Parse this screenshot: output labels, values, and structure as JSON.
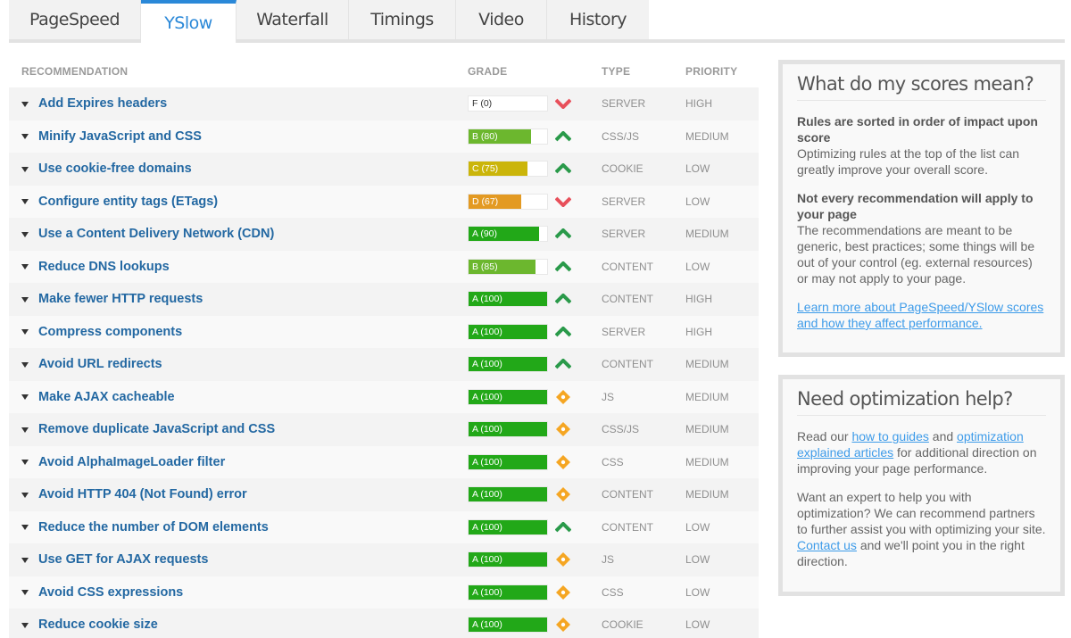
{
  "tabs": [
    {
      "label": "PageSpeed",
      "active": false
    },
    {
      "label": "YSlow",
      "active": true
    },
    {
      "label": "Waterfall",
      "active": false
    },
    {
      "label": "Timings",
      "active": false
    },
    {
      "label": "Video",
      "active": false
    },
    {
      "label": "History",
      "active": false
    }
  ],
  "table": {
    "headers": {
      "recommendation": "RECOMMENDATION",
      "grade": "GRADE",
      "type": "TYPE",
      "priority": "PRIORITY"
    },
    "rows": [
      {
        "name": "Add Expires headers",
        "grade": "F (0)",
        "score": 0,
        "color": "#ffffff",
        "trend": "down",
        "type": "SERVER",
        "priority": "HIGH"
      },
      {
        "name": "Minify JavaScript and CSS",
        "grade": "B (80)",
        "score": 80,
        "color": "#6cb72e",
        "trend": "up",
        "type": "CSS/JS",
        "priority": "MEDIUM"
      },
      {
        "name": "Use cookie-free domains",
        "grade": "C (75)",
        "score": 75,
        "color": "#cbb50a",
        "trend": "up",
        "type": "COOKIE",
        "priority": "LOW"
      },
      {
        "name": "Configure entity tags (ETags)",
        "grade": "D (67)",
        "score": 67,
        "color": "#e39a23",
        "trend": "down",
        "type": "SERVER",
        "priority": "LOW"
      },
      {
        "name": "Use a Content Delivery Network (CDN)",
        "grade": "A (90)",
        "score": 90,
        "color": "#22a818",
        "trend": "up",
        "type": "SERVER",
        "priority": "MEDIUM"
      },
      {
        "name": "Reduce DNS lookups",
        "grade": "B (85)",
        "score": 85,
        "color": "#6cb72e",
        "trend": "up",
        "type": "CONTENT",
        "priority": "LOW"
      },
      {
        "name": "Make fewer HTTP requests",
        "grade": "A (100)",
        "score": 100,
        "color": "#22a818",
        "trend": "up",
        "type": "CONTENT",
        "priority": "HIGH"
      },
      {
        "name": "Compress components",
        "grade": "A (100)",
        "score": 100,
        "color": "#22a818",
        "trend": "up",
        "type": "SERVER",
        "priority": "HIGH"
      },
      {
        "name": "Avoid URL redirects",
        "grade": "A (100)",
        "score": 100,
        "color": "#22a818",
        "trend": "up",
        "type": "CONTENT",
        "priority": "MEDIUM"
      },
      {
        "name": "Make AJAX cacheable",
        "grade": "A (100)",
        "score": 100,
        "color": "#22a818",
        "trend": "neutral",
        "type": "JS",
        "priority": "MEDIUM"
      },
      {
        "name": "Remove duplicate JavaScript and CSS",
        "grade": "A (100)",
        "score": 100,
        "color": "#22a818",
        "trend": "neutral",
        "type": "CSS/JS",
        "priority": "MEDIUM"
      },
      {
        "name": "Avoid AlphaImageLoader filter",
        "grade": "A (100)",
        "score": 100,
        "color": "#22a818",
        "trend": "neutral",
        "type": "CSS",
        "priority": "MEDIUM"
      },
      {
        "name": "Avoid HTTP 404 (Not Found) error",
        "grade": "A (100)",
        "score": 100,
        "color": "#22a818",
        "trend": "neutral",
        "type": "CONTENT",
        "priority": "MEDIUM"
      },
      {
        "name": "Reduce the number of DOM elements",
        "grade": "A (100)",
        "score": 100,
        "color": "#22a818",
        "trend": "up",
        "type": "CONTENT",
        "priority": "LOW"
      },
      {
        "name": "Use GET for AJAX requests",
        "grade": "A (100)",
        "score": 100,
        "color": "#22a818",
        "trend": "neutral",
        "type": "JS",
        "priority": "LOW"
      },
      {
        "name": "Avoid CSS expressions",
        "grade": "A (100)",
        "score": 100,
        "color": "#22a818",
        "trend": "neutral",
        "type": "CSS",
        "priority": "LOW"
      },
      {
        "name": "Reduce cookie size",
        "grade": "A (100)",
        "score": 100,
        "color": "#22a818",
        "trend": "neutral",
        "type": "COOKIE",
        "priority": "LOW"
      }
    ]
  },
  "trend_icons": {
    "up": {
      "icon": "chevron-up-icon",
      "color": "#2a9a4a"
    },
    "down": {
      "icon": "chevron-down-icon",
      "color": "#e8505b"
    },
    "neutral": {
      "icon": "diamond-icon",
      "color": "#f5a623"
    }
  },
  "scores_panel": {
    "title": "What do my scores mean?",
    "section1_heading": "Rules are sorted in order of impact upon score",
    "section1_text": "Optimizing rules at the top of the list can greatly improve your overall score.",
    "section2_heading": "Not every recommendation will apply to your page",
    "section2_text": "The recommendations are meant to be generic, best practices; some things will be out of your control (eg. external resources) or may not apply to your page.",
    "learn_more_link": "Learn more about PageSpeed/YSlow scores and how they affect performance."
  },
  "help_panel": {
    "title": "Need optimization help?",
    "p1_prefix": "Read our ",
    "p1_link1": "how to guides",
    "p1_mid": " and ",
    "p1_link2": "optimization explained articles",
    "p1_suffix": " for additional direction on improving your page performance.",
    "p2_prefix": "Want an expert to help you with optimization? We can recommend partners to further assist you with optimizing your site. ",
    "p2_link": "Contact us",
    "p2_suffix": " and we'll point you in the right direction."
  }
}
